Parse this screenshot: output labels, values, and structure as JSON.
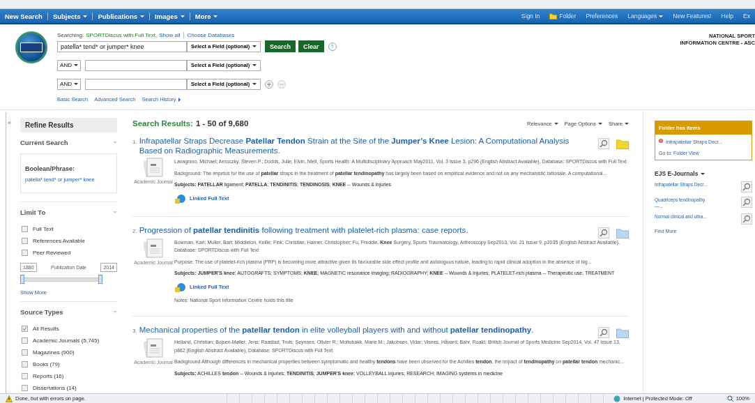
{
  "nav": {
    "left": [
      {
        "label": "New Search",
        "has_menu": false
      },
      {
        "label": "Subjects",
        "has_menu": true
      },
      {
        "label": "Publications",
        "has_menu": true
      },
      {
        "label": "Images",
        "has_menu": true
      },
      {
        "label": "More",
        "has_menu": true
      }
    ],
    "right": [
      {
        "label": "Sign In",
        "kind": "link"
      },
      {
        "label": "Folder",
        "kind": "folder"
      },
      {
        "label": "Preferences",
        "kind": "link"
      },
      {
        "label": "Languages",
        "kind": "menu"
      },
      {
        "label": "New Features!",
        "kind": "link"
      },
      {
        "label": "Help",
        "kind": "link"
      },
      {
        "label": "Ex",
        "kind": "link"
      }
    ]
  },
  "search": {
    "searching_label": "Searching:",
    "database": "SPORTDiscus with Full Text,",
    "show_all": "Show all",
    "choose_databases": "Choose Databases",
    "rows": [
      {
        "operator": "",
        "value": "patella* tend* or jumper* knee",
        "field": "Select a Field (optional)"
      },
      {
        "operator": "AND",
        "value": "",
        "field": "Select a Field (optional)"
      },
      {
        "operator": "AND",
        "value": "",
        "field": "Select a Field (optional)"
      }
    ],
    "search_button": "Search",
    "clear_button": "Clear",
    "help": "?",
    "links": [
      "Basic Search",
      "Advanced Search",
      "Search History"
    ],
    "institution": [
      "NATIONAL SPORT",
      "INFORMATION CENTRE - ASC"
    ]
  },
  "sidebar": {
    "collapse": "«",
    "title": "Refine Results",
    "current_search": {
      "heading": "Current Search",
      "label": "Boolean/Phrase:",
      "query": "patella* tend* or jumper* knee"
    },
    "limit_to": {
      "heading": "Limit To",
      "options": [
        {
          "label": "Full Text",
          "checked": false
        },
        {
          "label": "References Available",
          "checked": false
        },
        {
          "label": "Peer Reviewed",
          "checked": false
        }
      ],
      "date_from": "1880",
      "date_label": "Publication Date",
      "date_to": "2014",
      "date_slider": {
        "level": 1
      },
      "show_more": "Show More"
    },
    "source_types": {
      "heading": "Source Types",
      "options": [
        {
          "label": "All Results",
          "checked": true
        },
        {
          "label": "Academic Journals (5,745)",
          "checked": false
        },
        {
          "label": "Magazines (900)",
          "checked": false
        },
        {
          "label": "Books (79)",
          "checked": false
        },
        {
          "label": "Reports (16)",
          "checked": false
        },
        {
          "label": "Dissertations (14)",
          "checked": false
        }
      ]
    }
  },
  "results": {
    "heading": "Search Results:",
    "range": "1 - 50 of 9,680",
    "options": [
      "Relevance",
      "Page Options",
      "Share"
    ],
    "items": [
      {
        "number": "1.",
        "title": "Infrapatellar Straps Decrease **Patellar Tendon** Strain at the Site of the **Jumper’s Knee** Lesion: A Computational Analysis Based on Radiographic Measurements.",
        "type": "Academic Journal",
        "in_folder": true,
        "meta": "Lavagnino, Michael; Arnoczky, Steven P.; Dodds, Julie; Elvin, Niell, Sports Health: A Multidisciplinary Approach May2011, Vol. 3 Issue 3, p296 (English Abstract Available), Database: SPORTDiscus with Full Text",
        "abstract": "Background: The impetus for the use of **patellar** straps in the treatment of **patellar tendinopathy** has largely been based on empirical evidence and not on any mechanistic rationale. A computational...",
        "subjects": "**Subjects: PATELLAR** ligament; **PATELLA**; **TENDINITIS**; **TENDINOSIS**; **KNEE** -- Wounds & injuries",
        "full_text": "Linked Full Text"
      },
      {
        "number": "2.",
        "title": "Progression of **patellar tendinitis** following treatment with platelet-rich plasma: case reports.",
        "type": "Academic Journal",
        "in_folder": false,
        "meta": "Bowman, Karl; Muller, Bart; Middleton, Kellie; Fink, Christian; Harner, Christopher; Fu, Freddie, **Knee** Surgery, Sports Traumatology, Arthroscopy Sep2013, Vol. 21 Issue 9, p2035 (English Abstract Available), Database: SPORTDiscus with Full Text",
        "abstract": "Purpose: The use of platelet-rich plasma (PRP) is becoming more attractive given its favourable side effect profile and autologous nature, leading to rapid clinical adoption in the absence of hig...",
        "subjects": "**Subjects: JUMPER'S knee**; AUTOGRAFTS; SYMPTOMS; **KNEE**; MAGNETIC resonance imaging; RADIOGRAPHY; **KNEE** -- Wounds & injuries; PLATELET-rich plasma -- Therapeutic use; TREATMENT",
        "full_text": "Linked Full Text",
        "notes": "Notes:  National Sport Information Centre holds this title"
      },
      {
        "number": "3.",
        "title": "Mechanical properties of the **patellar tendon** in elite volleyball players with and without **patellar tendinopathy**.",
        "type": "Academic Journal",
        "in_folder": false,
        "meta": "Helland, Christian; Bojsen-Møller, Jens; Raastad, Truls; Seynnes, Olivier R.; Moltubakk, Marie M.; Jakobsen, Vidar; Visnes, Håvard; Bahr, Roald, British Journal of Sports Medicine Sep2014, Vol. 47 Issue 13, p862 (English Abstract Available), Database: SPORTDiscus with Full Text",
        "abstract": "Background Although differences in mechanical properties between symptomatic and healthy **tendons** have been observed for the Achilles **tendon**, the impact of **tendinopathy** on **patellar tendon** mechanic...",
        "subjects": "**Subjects:** ACHILLES **tendon** -- Wounds & injuries; **TENDINITIS**; **JUMPER'S knee**; VOLLEYBALL injuries; RESEARCH; IMAGING systems in medicine"
      }
    ]
  },
  "right_panel": {
    "folder_heading": "Folder has items",
    "folder_items": [
      "Infrapatellar Straps Decr..."
    ],
    "goto_label": "Go to:",
    "folder_view": "Folder View",
    "journals_heading": "EJS E-Journals",
    "journals": [
      "Infrapatellar Straps Decr...",
      "Quadriceps tendinopathy —...",
      "Normal clinical and ultra..."
    ],
    "find_more": "Find More"
  },
  "status_bar": {
    "message": "Done, but with errors on page.",
    "zone": "Internet | Protected Mode: Off",
    "zoom": "100%"
  }
}
